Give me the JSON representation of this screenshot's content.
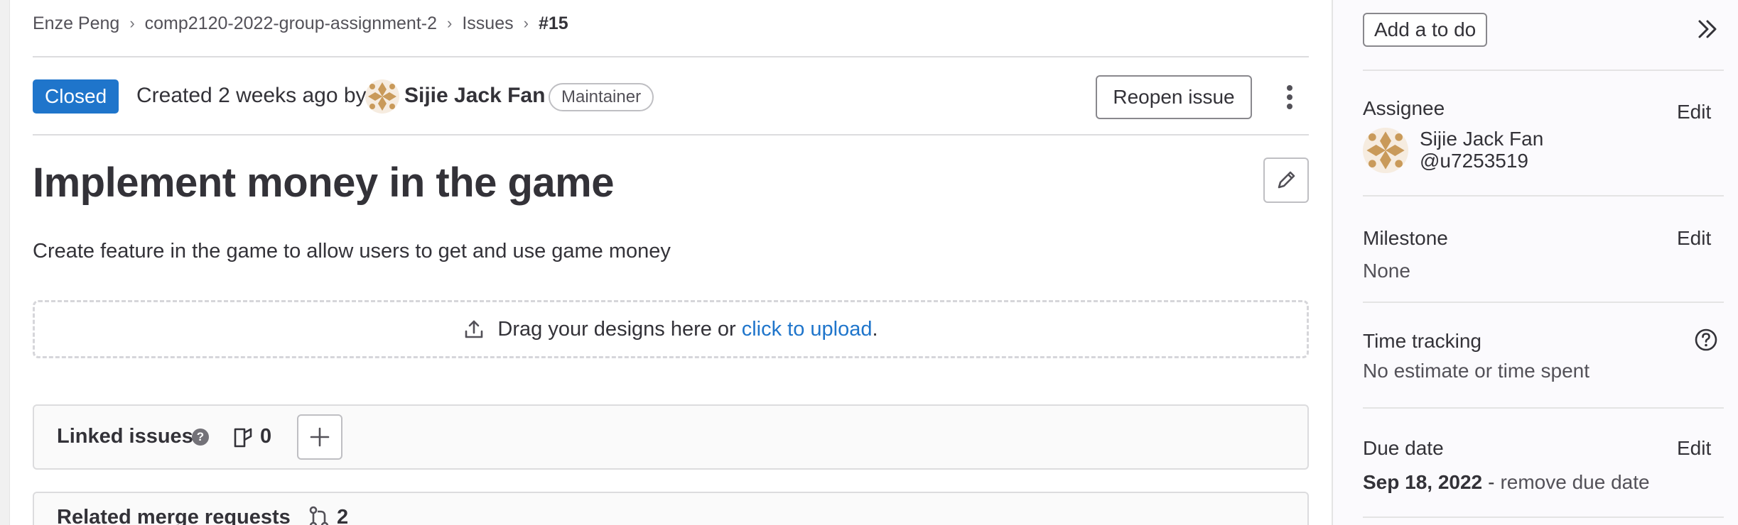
{
  "breadcrumb": {
    "items": [
      "Enze Peng",
      "comp2120-2022-group-assignment-2",
      "Issues"
    ],
    "current": "#15"
  },
  "issue": {
    "status": "Closed",
    "created_text": "Created 2 weeks ago by",
    "author": "Sijie Jack Fan",
    "author_role": "Maintainer",
    "reopen_label": "Reopen issue",
    "title": "Implement money in the game",
    "description": "Create feature in the game to allow users to get and use game money"
  },
  "designs": {
    "prompt": "Drag your designs here or",
    "link": "click to upload",
    "suffix": "."
  },
  "linked_issues": {
    "title": "Linked issues",
    "help": "?",
    "count": "0"
  },
  "related_mrs": {
    "title": "Related merge requests",
    "count": "2"
  },
  "sidebar": {
    "todo_label": "Add a to do",
    "assignee": {
      "label": "Assignee",
      "edit": "Edit",
      "name": "Sijie Jack Fan",
      "handle": "@u7253519"
    },
    "milestone": {
      "label": "Milestone",
      "edit": "Edit",
      "value": "None"
    },
    "time_tracking": {
      "label": "Time tracking",
      "value": "No estimate or time spent"
    },
    "due_date": {
      "label": "Due date",
      "edit": "Edit",
      "date": "Sep 18, 2022",
      "separator": "-",
      "remove": "remove due date"
    }
  },
  "colors": {
    "accent": "#1f75cb",
    "closed_badge": "#1f75cb",
    "text": "#333238",
    "avatar": "#c99a5a"
  },
  "icons": [
    "chevron-right-icon",
    "kebab-icon",
    "pencil-icon",
    "upload-icon",
    "help-icon",
    "issue-icon",
    "plus-icon",
    "merge-request-icon",
    "double-chevron-right-icon",
    "question-circle-icon"
  ]
}
